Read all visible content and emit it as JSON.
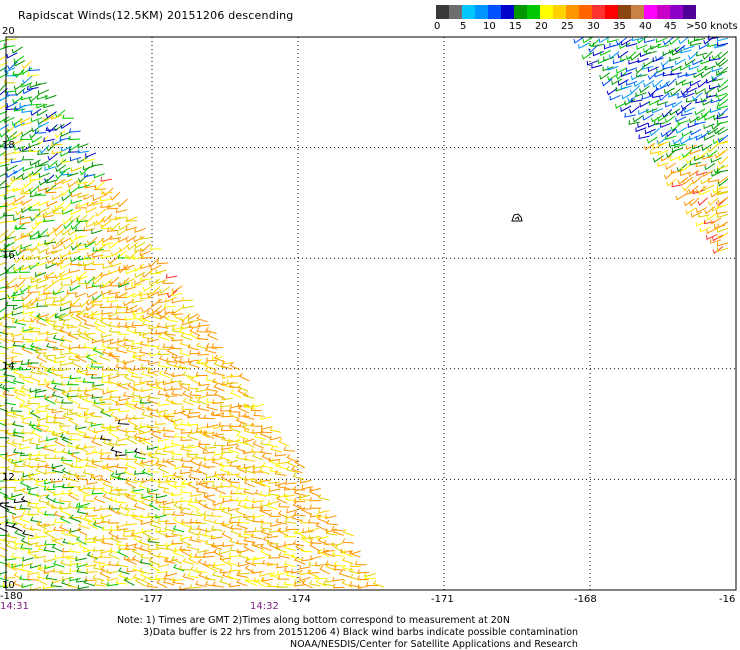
{
  "title": "Rapidscat Winds(12.5KM) 20151206 descending",
  "legend": {
    "colors": [
      "#3a3a3a",
      "#6e6e6e",
      "#00c8ff",
      "#0096ff",
      "#0050ff",
      "#0000c8",
      "#009600",
      "#00c800",
      "#ffff00",
      "#ffd200",
      "#ff9600",
      "#ff6400",
      "#ff3232",
      "#ff0000",
      "#8b4513",
      "#c88246",
      "#ff00ff",
      "#c800c8",
      "#8c00c8",
      "#500096"
    ],
    "labels": [
      "0",
      "5",
      "10",
      "15",
      "20",
      "25",
      "30",
      "35",
      "40",
      "45",
      ">50 knots"
    ]
  },
  "axes": {
    "lon_labels": [
      "-180",
      "-177",
      "-174",
      "-171",
      "-168",
      "-16"
    ],
    "lat_labels": [
      "20",
      "18",
      "16",
      "14",
      "12",
      "10"
    ]
  },
  "chart_data": {
    "type": "map",
    "lon_range": [
      -180,
      -165
    ],
    "lat_range": [
      10,
      20
    ],
    "gridlines": true,
    "grid_lon": [
      -177,
      -174,
      -171,
      -168
    ],
    "grid_lat": [
      18,
      16,
      14,
      12
    ],
    "island_marker_lonlat": [
      -169.8,
      16.7
    ]
  },
  "pass_times": [
    "14:31",
    "14:32"
  ],
  "notes": [
    "Note: 1) Times are GMT 2)Times along bottom correspond to measurement at 20N",
    "3)Data buffer is 22 hrs from 20151206 4) Black wind barbs indicate possible contamination",
    "NOAA/NESDIS/Center for Satellite Applications and Research"
  ]
}
